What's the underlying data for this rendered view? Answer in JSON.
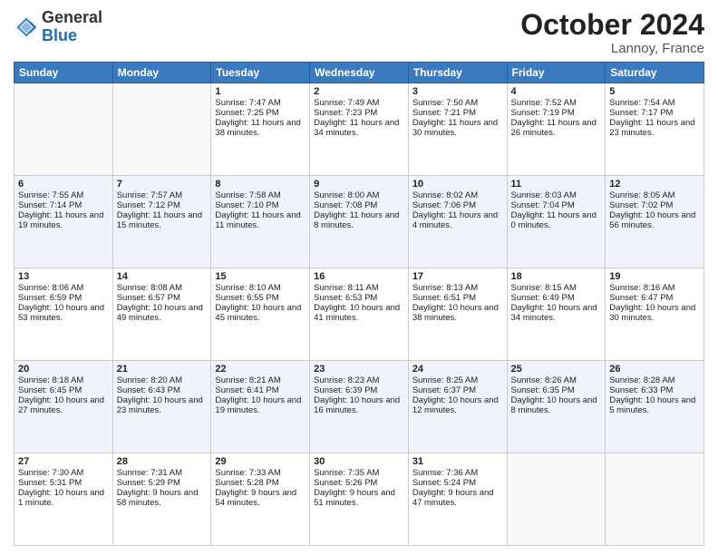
{
  "header": {
    "logo_general": "General",
    "logo_blue": "Blue",
    "month_title": "October 2024",
    "location": "Lannoy, France"
  },
  "weekdays": [
    "Sunday",
    "Monday",
    "Tuesday",
    "Wednesday",
    "Thursday",
    "Friday",
    "Saturday"
  ],
  "weeks": [
    [
      {
        "day": "",
        "info": ""
      },
      {
        "day": "",
        "info": ""
      },
      {
        "day": "1",
        "info": "Sunrise: 7:47 AM\nSunset: 7:25 PM\nDaylight: 11 hours and 38 minutes."
      },
      {
        "day": "2",
        "info": "Sunrise: 7:49 AM\nSunset: 7:23 PM\nDaylight: 11 hours and 34 minutes."
      },
      {
        "day": "3",
        "info": "Sunrise: 7:50 AM\nSunset: 7:21 PM\nDaylight: 11 hours and 30 minutes."
      },
      {
        "day": "4",
        "info": "Sunrise: 7:52 AM\nSunset: 7:19 PM\nDaylight: 11 hours and 26 minutes."
      },
      {
        "day": "5",
        "info": "Sunrise: 7:54 AM\nSunset: 7:17 PM\nDaylight: 11 hours and 23 minutes."
      }
    ],
    [
      {
        "day": "6",
        "info": "Sunrise: 7:55 AM\nSunset: 7:14 PM\nDaylight: 11 hours and 19 minutes."
      },
      {
        "day": "7",
        "info": "Sunrise: 7:57 AM\nSunset: 7:12 PM\nDaylight: 11 hours and 15 minutes."
      },
      {
        "day": "8",
        "info": "Sunrise: 7:58 AM\nSunset: 7:10 PM\nDaylight: 11 hours and 11 minutes."
      },
      {
        "day": "9",
        "info": "Sunrise: 8:00 AM\nSunset: 7:08 PM\nDaylight: 11 hours and 8 minutes."
      },
      {
        "day": "10",
        "info": "Sunrise: 8:02 AM\nSunset: 7:06 PM\nDaylight: 11 hours and 4 minutes."
      },
      {
        "day": "11",
        "info": "Sunrise: 8:03 AM\nSunset: 7:04 PM\nDaylight: 11 hours and 0 minutes."
      },
      {
        "day": "12",
        "info": "Sunrise: 8:05 AM\nSunset: 7:02 PM\nDaylight: 10 hours and 56 minutes."
      }
    ],
    [
      {
        "day": "13",
        "info": "Sunrise: 8:06 AM\nSunset: 6:59 PM\nDaylight: 10 hours and 53 minutes."
      },
      {
        "day": "14",
        "info": "Sunrise: 8:08 AM\nSunset: 6:57 PM\nDaylight: 10 hours and 49 minutes."
      },
      {
        "day": "15",
        "info": "Sunrise: 8:10 AM\nSunset: 6:55 PM\nDaylight: 10 hours and 45 minutes."
      },
      {
        "day": "16",
        "info": "Sunrise: 8:11 AM\nSunset: 6:53 PM\nDaylight: 10 hours and 41 minutes."
      },
      {
        "day": "17",
        "info": "Sunrise: 8:13 AM\nSunset: 6:51 PM\nDaylight: 10 hours and 38 minutes."
      },
      {
        "day": "18",
        "info": "Sunrise: 8:15 AM\nSunset: 6:49 PM\nDaylight: 10 hours and 34 minutes."
      },
      {
        "day": "19",
        "info": "Sunrise: 8:16 AM\nSunset: 6:47 PM\nDaylight: 10 hours and 30 minutes."
      }
    ],
    [
      {
        "day": "20",
        "info": "Sunrise: 8:18 AM\nSunset: 6:45 PM\nDaylight: 10 hours and 27 minutes."
      },
      {
        "day": "21",
        "info": "Sunrise: 8:20 AM\nSunset: 6:43 PM\nDaylight: 10 hours and 23 minutes."
      },
      {
        "day": "22",
        "info": "Sunrise: 8:21 AM\nSunset: 6:41 PM\nDaylight: 10 hours and 19 minutes."
      },
      {
        "day": "23",
        "info": "Sunrise: 8:23 AM\nSunset: 6:39 PM\nDaylight: 10 hours and 16 minutes."
      },
      {
        "day": "24",
        "info": "Sunrise: 8:25 AM\nSunset: 6:37 PM\nDaylight: 10 hours and 12 minutes."
      },
      {
        "day": "25",
        "info": "Sunrise: 8:26 AM\nSunset: 6:35 PM\nDaylight: 10 hours and 8 minutes."
      },
      {
        "day": "26",
        "info": "Sunrise: 8:28 AM\nSunset: 6:33 PM\nDaylight: 10 hours and 5 minutes."
      }
    ],
    [
      {
        "day": "27",
        "info": "Sunrise: 7:30 AM\nSunset: 5:31 PM\nDaylight: 10 hours and 1 minute."
      },
      {
        "day": "28",
        "info": "Sunrise: 7:31 AM\nSunset: 5:29 PM\nDaylight: 9 hours and 58 minutes."
      },
      {
        "day": "29",
        "info": "Sunrise: 7:33 AM\nSunset: 5:28 PM\nDaylight: 9 hours and 54 minutes."
      },
      {
        "day": "30",
        "info": "Sunrise: 7:35 AM\nSunset: 5:26 PM\nDaylight: 9 hours and 51 minutes."
      },
      {
        "day": "31",
        "info": "Sunrise: 7:36 AM\nSunset: 5:24 PM\nDaylight: 9 hours and 47 minutes."
      },
      {
        "day": "",
        "info": ""
      },
      {
        "day": "",
        "info": ""
      }
    ]
  ]
}
